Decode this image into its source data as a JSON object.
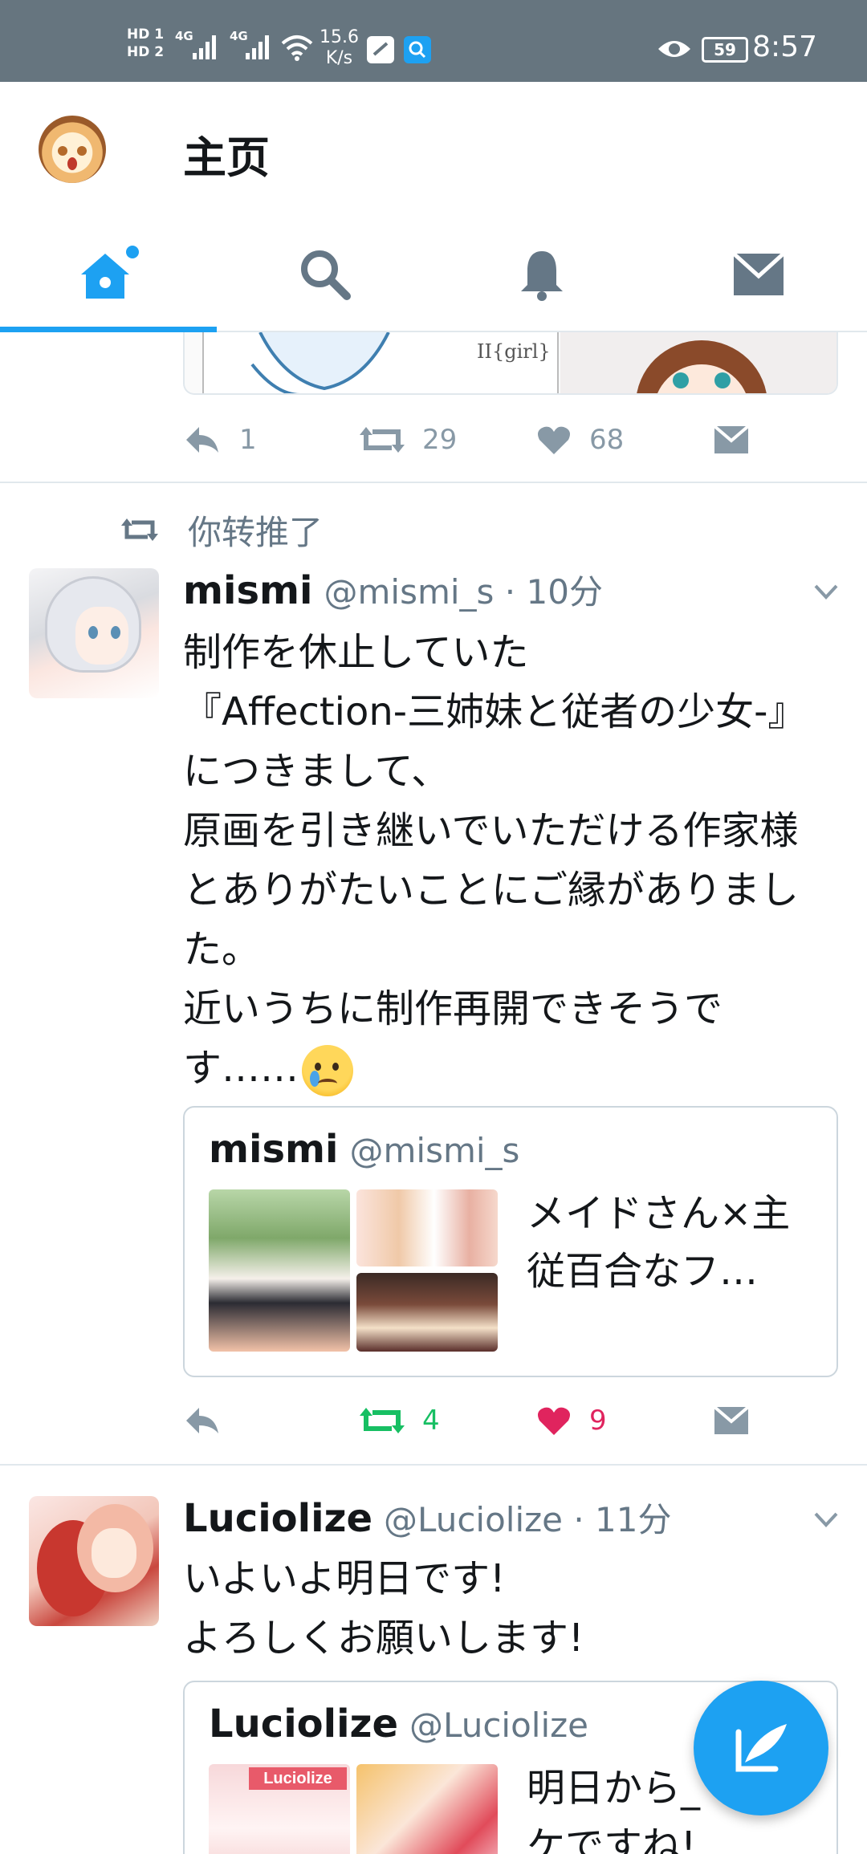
{
  "status_bar": {
    "hd1": "HD 1",
    "hd2": "HD 2",
    "sig1": "4G",
    "sig2": "4G",
    "speed_value": "15.6",
    "speed_unit": "K/s",
    "battery": "59",
    "time": "8:57"
  },
  "header": {
    "title": "主页"
  },
  "tabs": [
    {
      "name": "home",
      "icon": "home-icon",
      "active": true
    },
    {
      "name": "search",
      "icon": "search-icon",
      "active": false
    },
    {
      "name": "notifications",
      "icon": "bell-icon",
      "active": false
    },
    {
      "name": "messages",
      "icon": "mail-icon",
      "active": false
    }
  ],
  "tweet0": {
    "media_label": "II{girl}",
    "reply_count": "1",
    "retweet_count": "29",
    "like_count": "68"
  },
  "tweet1": {
    "retweet_context": "你转推了",
    "name": "mismi",
    "handle_time": "@mismi_s · 10分",
    "text": "制作を休止していた\n『Affection-三姉妹と従者の少女-』につきまして、\n原画を引き継いでいただける作家様とありがたいことにご縁がありました。\n近いうちに制作再開できそうです……",
    "emoji": "crying-face-emoji",
    "quote": {
      "name": "mismi",
      "handle": "@mismi_s",
      "text": "メイドさん×主従百合なフ…"
    },
    "reply_count": "",
    "retweet_count": "4",
    "like_count": "9"
  },
  "tweet2": {
    "name": "Luciolize",
    "handle_time": "@Luciolize · 11分",
    "text": "いよいよ明日です!\nよろしくお願いします!",
    "quote": {
      "name": "Luciolize",
      "handle": "@Luciolize",
      "text": "明日から_\nケですね!",
      "thumb_label": "Luciolize"
    }
  },
  "colors": {
    "accent": "#1da1f2",
    "retweet_active": "#17bf63",
    "like_active": "#e0245e",
    "muted": "#8899a6",
    "status_bar": "#66757f"
  }
}
